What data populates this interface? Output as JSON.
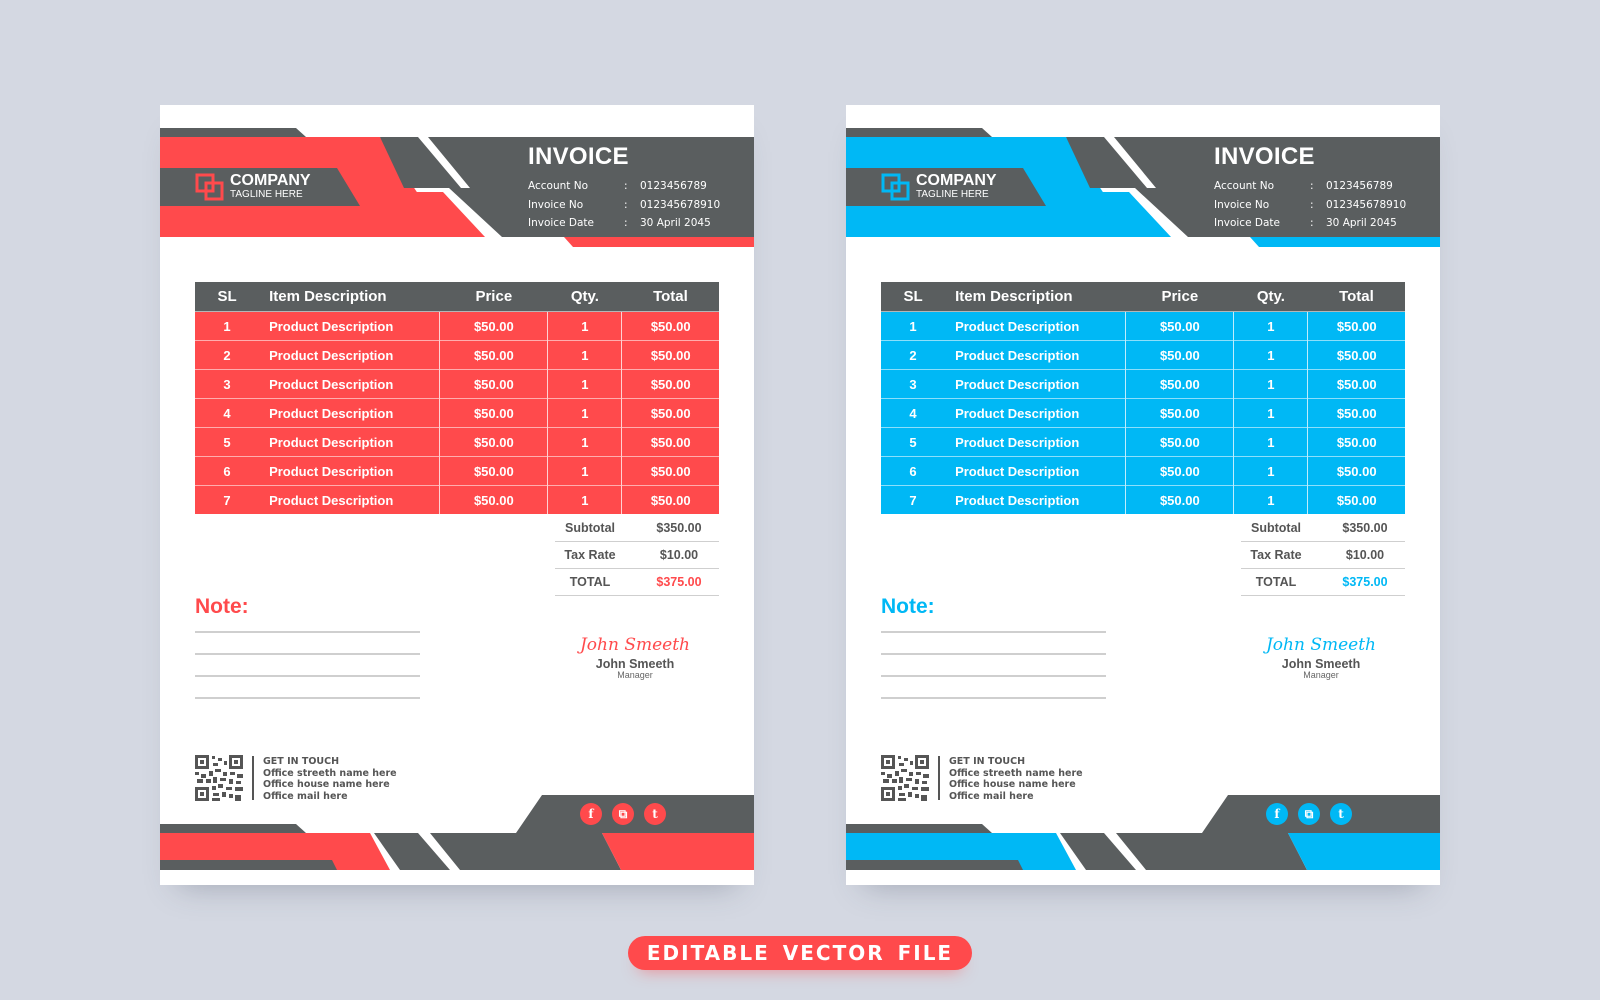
{
  "colors": {
    "background": "#d4d8e2",
    "dark": "#5a5e5f",
    "red_accent": "#ff4a4c",
    "blue_accent": "#00b8f5",
    "white": "#ffffff"
  },
  "banner": {
    "label": "EDITABLE VECTOR  FILE"
  },
  "invoices": [
    {
      "variant": "red",
      "accent": "#ff4a4c",
      "company": {
        "name": "COMPANY",
        "tagline": "TAGLINE HERE",
        "logo_icon": "overlapping-squares-logo"
      },
      "title": "INVOICE",
      "meta": [
        {
          "label": "Account No",
          "sep": ":",
          "value": "0123456789"
        },
        {
          "label": "Invoice No",
          "sep": ":",
          "value": "012345678910"
        },
        {
          "label": "Invoice Date",
          "sep": ":",
          "value": "30 April 2045"
        }
      ],
      "table": {
        "headers": [
          "SL",
          "Item Description",
          "Price",
          "Qty.",
          "Total"
        ],
        "rows": [
          [
            "1",
            "Product Description",
            "$50.00",
            "1",
            "$50.00"
          ],
          [
            "2",
            "Product Description",
            "$50.00",
            "1",
            "$50.00"
          ],
          [
            "3",
            "Product Description",
            "$50.00",
            "1",
            "$50.00"
          ],
          [
            "4",
            "Product Description",
            "$50.00",
            "1",
            "$50.00"
          ],
          [
            "5",
            "Product Description",
            "$50.00",
            "1",
            "$50.00"
          ],
          [
            "6",
            "Product Description",
            "$50.00",
            "1",
            "$50.00"
          ],
          [
            "7",
            "Product Description",
            "$50.00",
            "1",
            "$50.00"
          ]
        ]
      },
      "totals": [
        {
          "label": "Subtotal",
          "value": "$350.00"
        },
        {
          "label": "Tax Rate",
          "value": "$10.00"
        },
        {
          "label": "TOTAL",
          "value": "$375.00"
        }
      ],
      "note_label": "Note:",
      "signature": {
        "script": "John Smeeth",
        "name": "John Smeeth",
        "role": "Manager"
      },
      "contact": {
        "heading": "GET IN TOUCH",
        "lines": [
          "Office streeth name here",
          "Office house name here",
          "Office mail here"
        ]
      },
      "social_icons": [
        {
          "name": "facebook-icon",
          "glyph": "f"
        },
        {
          "name": "instagram-icon",
          "glyph": "⧉"
        },
        {
          "name": "twitter-icon",
          "glyph": "t"
        }
      ]
    },
    {
      "variant": "blue",
      "accent": "#00b8f5",
      "company": {
        "name": "COMPANY",
        "tagline": "TAGLINE HERE",
        "logo_icon": "overlapping-squares-logo"
      },
      "title": "INVOICE",
      "meta": [
        {
          "label": "Account No",
          "sep": ":",
          "value": "0123456789"
        },
        {
          "label": "Invoice No",
          "sep": ":",
          "value": "012345678910"
        },
        {
          "label": "Invoice Date",
          "sep": ":",
          "value": "30 April 2045"
        }
      ],
      "table": {
        "headers": [
          "SL",
          "Item Description",
          "Price",
          "Qty.",
          "Total"
        ],
        "rows": [
          [
            "1",
            "Product Description",
            "$50.00",
            "1",
            "$50.00"
          ],
          [
            "2",
            "Product Description",
            "$50.00",
            "1",
            "$50.00"
          ],
          [
            "3",
            "Product Description",
            "$50.00",
            "1",
            "$50.00"
          ],
          [
            "4",
            "Product Description",
            "$50.00",
            "1",
            "$50.00"
          ],
          [
            "5",
            "Product Description",
            "$50.00",
            "1",
            "$50.00"
          ],
          [
            "6",
            "Product Description",
            "$50.00",
            "1",
            "$50.00"
          ],
          [
            "7",
            "Product Description",
            "$50.00",
            "1",
            "$50.00"
          ]
        ]
      },
      "totals": [
        {
          "label": "Subtotal",
          "value": "$350.00"
        },
        {
          "label": "Tax Rate",
          "value": "$10.00"
        },
        {
          "label": "TOTAL",
          "value": "$375.00"
        }
      ],
      "note_label": "Note:",
      "signature": {
        "script": "John Smeeth",
        "name": "John Smeeth",
        "role": "Manager"
      },
      "contact": {
        "heading": "GET IN TOUCH",
        "lines": [
          "Office streeth name here",
          "Office house name here",
          "Office mail here"
        ]
      },
      "social_icons": [
        {
          "name": "facebook-icon",
          "glyph": "f"
        },
        {
          "name": "instagram-icon",
          "glyph": "⧉"
        },
        {
          "name": "twitter-icon",
          "glyph": "t"
        }
      ]
    }
  ]
}
